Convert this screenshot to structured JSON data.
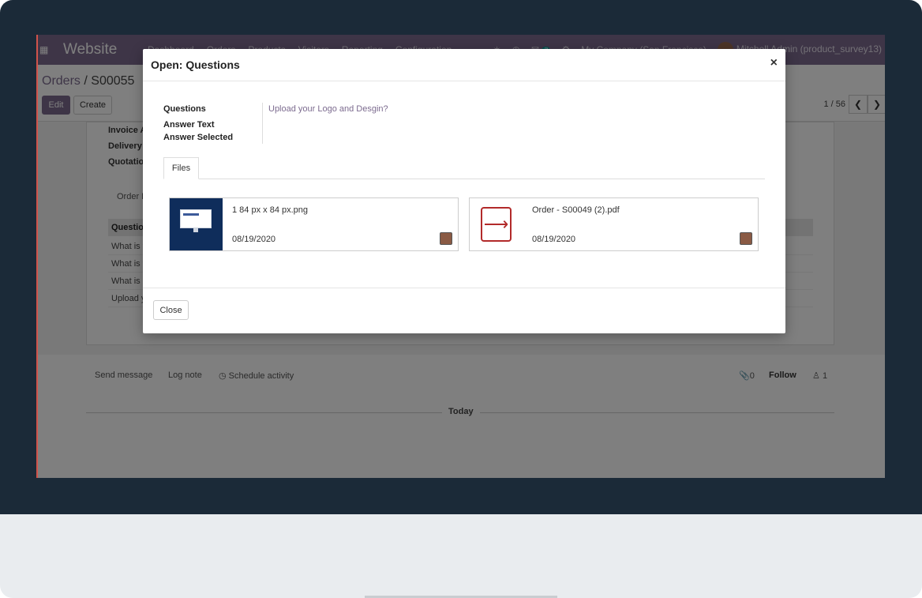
{
  "navbar": {
    "brand": "Website",
    "menu": [
      "Dashboard",
      "Orders",
      "Products",
      "Visitors",
      "Reporting",
      "Configuration"
    ],
    "messages_count": "7",
    "company": "My Company (San Francisco)",
    "user": "Mitchell Admin (product_survey13)"
  },
  "control": {
    "breadcrumb_parent": "Orders",
    "breadcrumb_sep": "/",
    "breadcrumb_current": "S00055",
    "edit_label": "Edit",
    "create_label": "Create",
    "pager": "1 / 56"
  },
  "form": {
    "labels": [
      "Invoice A",
      "Delivery A",
      "Quotation"
    ],
    "tab_label": "Order L",
    "grid_header": "Question",
    "grid_rows": [
      "What is y",
      "What is y",
      "What is C",
      "Upload y"
    ]
  },
  "chatter": {
    "send_message": "Send message",
    "log_note": "Log note",
    "schedule_activity": "Schedule activity",
    "attachments_count": "0",
    "follow": "Follow",
    "followers_count": "1",
    "today": "Today"
  },
  "modal": {
    "title": "Open: Questions",
    "fields": {
      "questions_label": "Questions",
      "questions_value": "Upload your Logo and Desgin?",
      "answer_text_label": "Answer Text",
      "answer_selected_label": "Answer Selected"
    },
    "tab_files": "Files",
    "attachments": [
      {
        "name": "1 84 px x 84 px.png",
        "date": "08/19/2020",
        "type": "image"
      },
      {
        "name": "Order - S00049 (2).pdf",
        "date": "08/19/2020",
        "type": "pdf"
      }
    ],
    "close_label": "Close"
  },
  "colors": {
    "brand": "#7c6b8f",
    "bezel": "#1b2a38",
    "pdf_red": "#b22a2a"
  }
}
